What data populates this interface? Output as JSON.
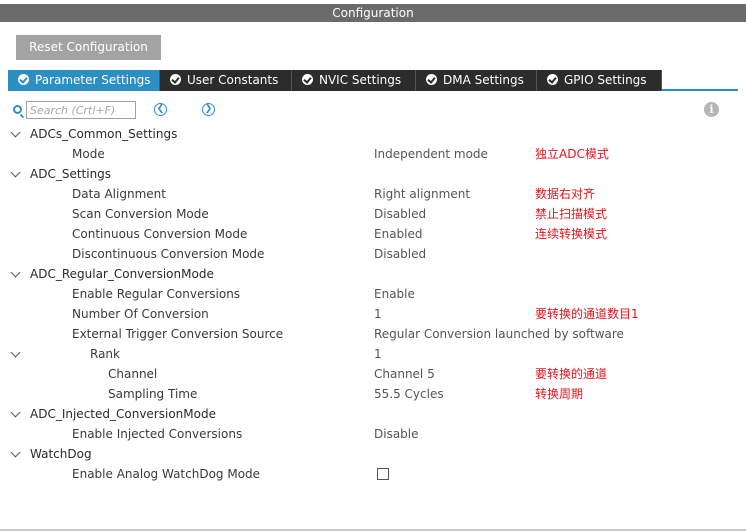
{
  "window": {
    "title": "Configuration"
  },
  "toolbar": {
    "reset_label": "Reset Configuration"
  },
  "tabs": [
    {
      "label": "Parameter Settings",
      "active": true
    },
    {
      "label": "User Constants",
      "active": false
    },
    {
      "label": "NVIC Settings",
      "active": false
    },
    {
      "label": "DMA Settings",
      "active": false
    },
    {
      "label": "GPIO Settings",
      "active": false
    }
  ],
  "search": {
    "placeholder": "Search (Crtl+F)",
    "value": ""
  },
  "icons": {
    "search": "search-icon",
    "prev": "arrow-left-circle-icon",
    "next": "arrow-right-circle-icon",
    "info": "info-icon",
    "tab_check": "check-circle-icon",
    "expand": "chevron-down-icon"
  },
  "colors": {
    "accent": "#2c8fc4",
    "tab_dark": "#2c2c2c",
    "note": "#e8141c",
    "title_bar": "#6b6b6b"
  },
  "groups": {
    "common": {
      "label": "ADCs_Common_Settings",
      "mode": {
        "label": "Mode",
        "value": "Independent mode",
        "note": "独立ADC模式"
      }
    },
    "adc": {
      "label": "ADC_Settings",
      "data_alignment": {
        "label": "Data Alignment",
        "value": "Right alignment",
        "note": "数据右对齐"
      },
      "scan_mode": {
        "label": "Scan Conversion Mode",
        "value": "Disabled",
        "note": "禁止扫描模式"
      },
      "continuous_mode": {
        "label": "Continuous Conversion Mode",
        "value": "Enabled",
        "note": "连续转换模式"
      },
      "discontinuous_mode": {
        "label": "Discontinuous Conversion Mode",
        "value": "Disabled"
      }
    },
    "regular": {
      "label": "ADC_Regular_ConversionMode",
      "enable": {
        "label": "Enable Regular Conversions",
        "value": "Enable"
      },
      "number": {
        "label": "Number Of Conversion",
        "value": "1",
        "note": "要转换的通道数目1"
      },
      "trigger": {
        "label": "External Trigger Conversion Source",
        "value": "Regular Conversion launched by software"
      },
      "rank": {
        "label": "Rank",
        "value": "1",
        "channel": {
          "label": "Channel",
          "value": "Channel 5",
          "note": "要转换的通道"
        },
        "sampling": {
          "label": "Sampling Time",
          "value": "55.5 Cycles",
          "note": "转换周期"
        }
      }
    },
    "injected": {
      "label": "ADC_Injected_ConversionMode",
      "enable": {
        "label": "Enable Injected Conversions",
        "value": "Disable"
      }
    },
    "watchdog": {
      "label": "WatchDog",
      "enable": {
        "label": "Enable Analog WatchDog Mode",
        "checked": false
      }
    }
  }
}
